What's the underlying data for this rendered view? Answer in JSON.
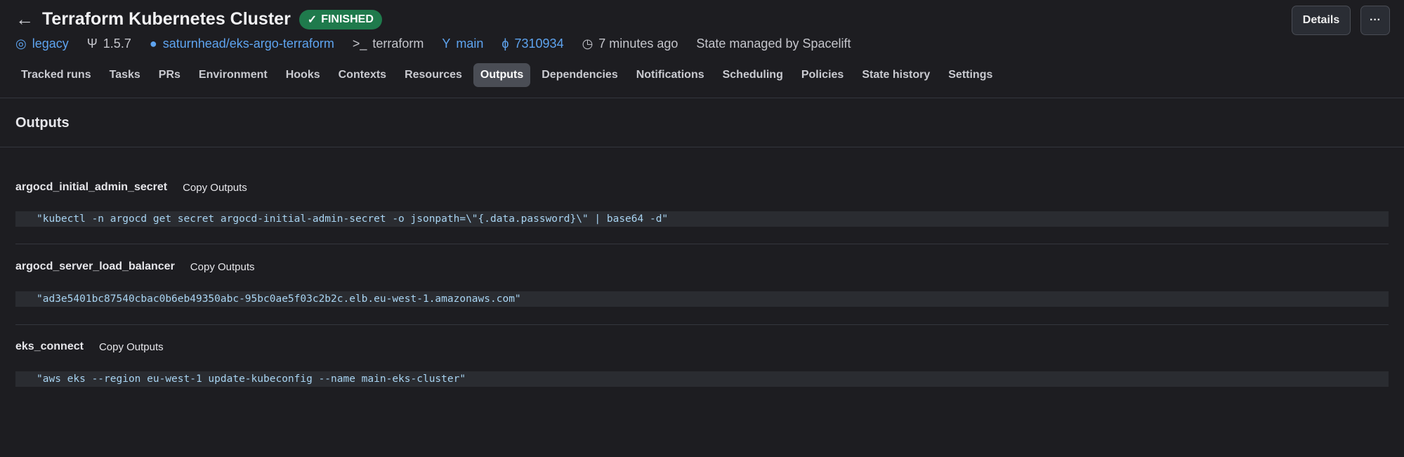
{
  "header": {
    "title": "Terraform Kubernetes Cluster",
    "status": "FINISHED",
    "details_label": "Details",
    "more_label": "···"
  },
  "meta": {
    "space": "legacy",
    "version": "1.5.7",
    "repo": "saturnhead/eks-argo-terraform",
    "tool": "terraform",
    "branch": "main",
    "commit": "7310934",
    "time": "7 minutes ago",
    "state": "State managed by Spacelift"
  },
  "tabs": [
    "Tracked runs",
    "Tasks",
    "PRs",
    "Environment",
    "Hooks",
    "Contexts",
    "Resources",
    "Outputs",
    "Dependencies",
    "Notifications",
    "Scheduling",
    "Policies",
    "State history",
    "Settings"
  ],
  "active_tab": "Outputs",
  "section_title": "Outputs",
  "outputs": [
    {
      "name": "argocd_initial_admin_secret",
      "copy": "Copy Outputs",
      "value": "\"kubectl -n argocd get secret argocd-initial-admin-secret -o jsonpath=\\\"{.data.password}\\\" | base64 -d\""
    },
    {
      "name": "argocd_server_load_balancer",
      "copy": "Copy Outputs",
      "value": "\"ad3e5401bc87540cbac0b6eb49350abc-95bc0ae5f03c2b2c.elb.eu-west-1.amazonaws.com\""
    },
    {
      "name": "eks_connect",
      "copy": "Copy Outputs",
      "value": "\"aws eks --region eu-west-1 update-kubeconfig --name main-eks-cluster\""
    }
  ]
}
